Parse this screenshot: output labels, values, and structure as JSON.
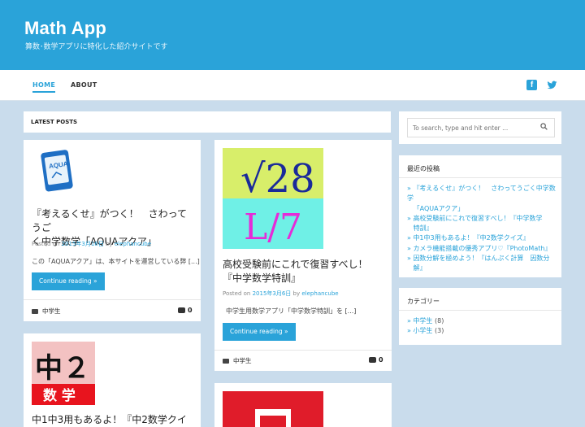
{
  "site": {
    "title": "Math App",
    "description": "算数･数学アプリに特化した紹介サイトです"
  },
  "nav": {
    "items": [
      {
        "label": "HOME"
      },
      {
        "label": "ABOUT"
      }
    ],
    "social": [
      "facebook-icon",
      "twitter-icon"
    ]
  },
  "main": {
    "section_title": "LATEST POSTS",
    "posts": [
      {
        "thumb_icon": "aqua-app-icon",
        "thumb_text": "AQUA",
        "title": "『考えるくせ』がつく！　さわってうごく中学数学「AQUAアクア」",
        "title_line1": "『考えるくせ』がつく！　さわってうご",
        "title_line2": "く中学数学「AQUAアクア」",
        "meta_prefix": "Posted on",
        "date": "2015年3月16日",
        "by": "by",
        "author": "elephancube",
        "excerpt": "この「AQUAアクア」は、本サイトを運営している弊 [...]",
        "button": "Continue reading »",
        "category": "中学生",
        "comments": "0"
      },
      {
        "thumb_icon": "tokkun-28-icon",
        "thumb_text": "√28",
        "thumb_text2": "L/7",
        "title": "高校受験前にこれで復習すべし！『中学数学特訓』",
        "title_line1": "高校受験前にこれで復習すべし！",
        "title_line2": "『中学数学特訓』",
        "meta_prefix": "Posted on",
        "date": "2015年3月6日",
        "by": "by",
        "author": "elephancube",
        "excerpt": "中学生用数学アプリ「中学数学特訓」を [...]",
        "button": "Continue reading »",
        "category": "中学生",
        "comments": "0"
      },
      {
        "thumb_icon": "chu2-sugaku-icon",
        "thumb_text": "中２",
        "thumb_text2": "数 学",
        "title_line1": "中1中3用もあるよ！『中2数学クイ"
      },
      {
        "thumb_icon": "red-app-icon"
      }
    ]
  },
  "sidebar": {
    "search_placeholder": "To search, type and hit enter ...",
    "recent": {
      "title": "最近の投稿",
      "items": [
        "『考えるくせ』がつく！　さわってうごく中学数学",
        "「AQUAアクア」",
        "高校受験前にこれで復習すべし！『中学数学",
        "特訓』",
        "中1中3用もあるよ！『中2数学クイズ』",
        "カメラ機能搭載の優秀アプリ♡『PhotoMath』",
        "因数分解を極めよう！『はんぷく計算　因数分",
        "解』"
      ]
    },
    "categories": {
      "title": "カテゴリー",
      "items": [
        {
          "label": "中学生",
          "count": "(8)"
        },
        {
          "label": "小学生",
          "count": "(3)"
        }
      ]
    }
  },
  "colors": {
    "accent": "#2aa3d9",
    "background": "#c9dcec"
  }
}
